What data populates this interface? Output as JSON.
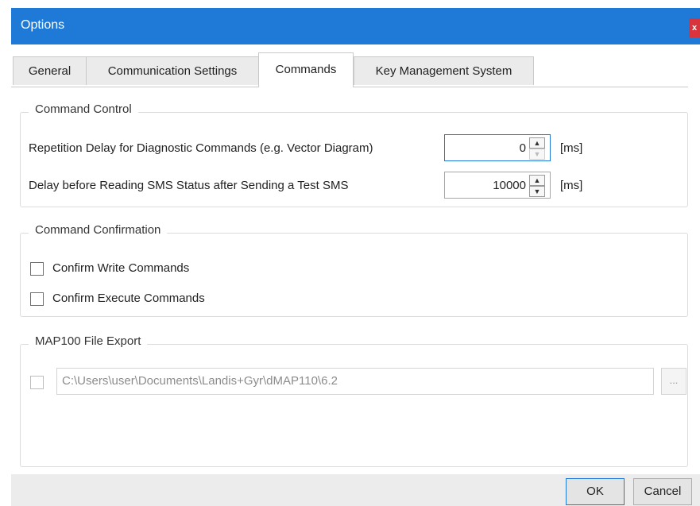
{
  "window": {
    "title": "Options",
    "close_label": "x"
  },
  "tabs": [
    {
      "label": "General",
      "active": false
    },
    {
      "label": "Communication Settings",
      "active": false
    },
    {
      "label": "Commands",
      "active": true
    },
    {
      "label": "Key Management System",
      "active": false
    }
  ],
  "command_control": {
    "title": "Command Control",
    "repetition_delay": {
      "label": "Repetition Delay for Diagnostic Commands (e.g. Vector Diagram)",
      "value": "0",
      "unit": "[ms]"
    },
    "sms_delay": {
      "label": "Delay before Reading SMS Status after Sending a Test SMS",
      "value": "10000",
      "unit": "[ms]"
    }
  },
  "command_confirmation": {
    "title": "Command Confirmation",
    "confirm_write": {
      "label": "Confirm Write Commands",
      "checked": false
    },
    "confirm_execute": {
      "label": "Confirm Execute Commands",
      "checked": false
    }
  },
  "file_export": {
    "title": "MAP100 File Export",
    "enabled": false,
    "path": "C:\\Users\\user\\Documents\\Landis+Gyr\\dMAP110\\6.2",
    "browse_label": "..."
  },
  "footer": {
    "ok_label": "OK",
    "cancel_label": "Cancel"
  },
  "colors": {
    "titlebar": "#1e7ad6",
    "close": "#d9343b",
    "footer": "#ececec"
  }
}
